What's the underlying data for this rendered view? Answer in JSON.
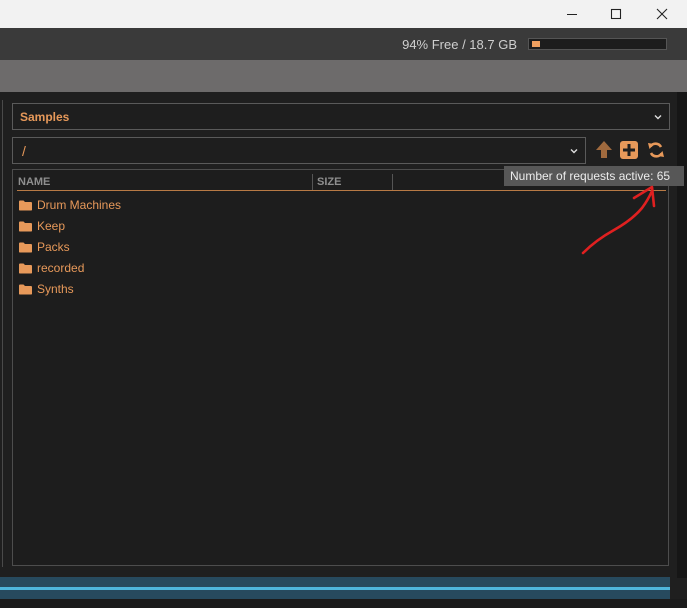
{
  "window": {
    "controls": [
      "minimize",
      "maximize",
      "close"
    ]
  },
  "header": {
    "storage_text": "94% Free / 18.7 GB",
    "storage_used_fraction": 0.06
  },
  "browser": {
    "location": "Samples",
    "path": "/",
    "columns": [
      "NAME",
      "SIZE"
    ],
    "items": [
      {
        "name": "Drum Machines",
        "icon": "folder-icon"
      },
      {
        "name": "Keep",
        "icon": "folder-icon"
      },
      {
        "name": "Packs",
        "icon": "folder-icon"
      },
      {
        "name": "recorded",
        "icon": "folder-icon"
      },
      {
        "name": "Synths",
        "icon": "folder-icon"
      }
    ],
    "toolbar_icons": [
      "arrow-up-icon",
      "new-folder-icon",
      "refresh-icon"
    ]
  },
  "tooltip": {
    "text": "Number of requests active: 65"
  },
  "colors": {
    "accent": "#e7995a",
    "waveform": "#4fb6dc",
    "annotation": "#e02020"
  }
}
